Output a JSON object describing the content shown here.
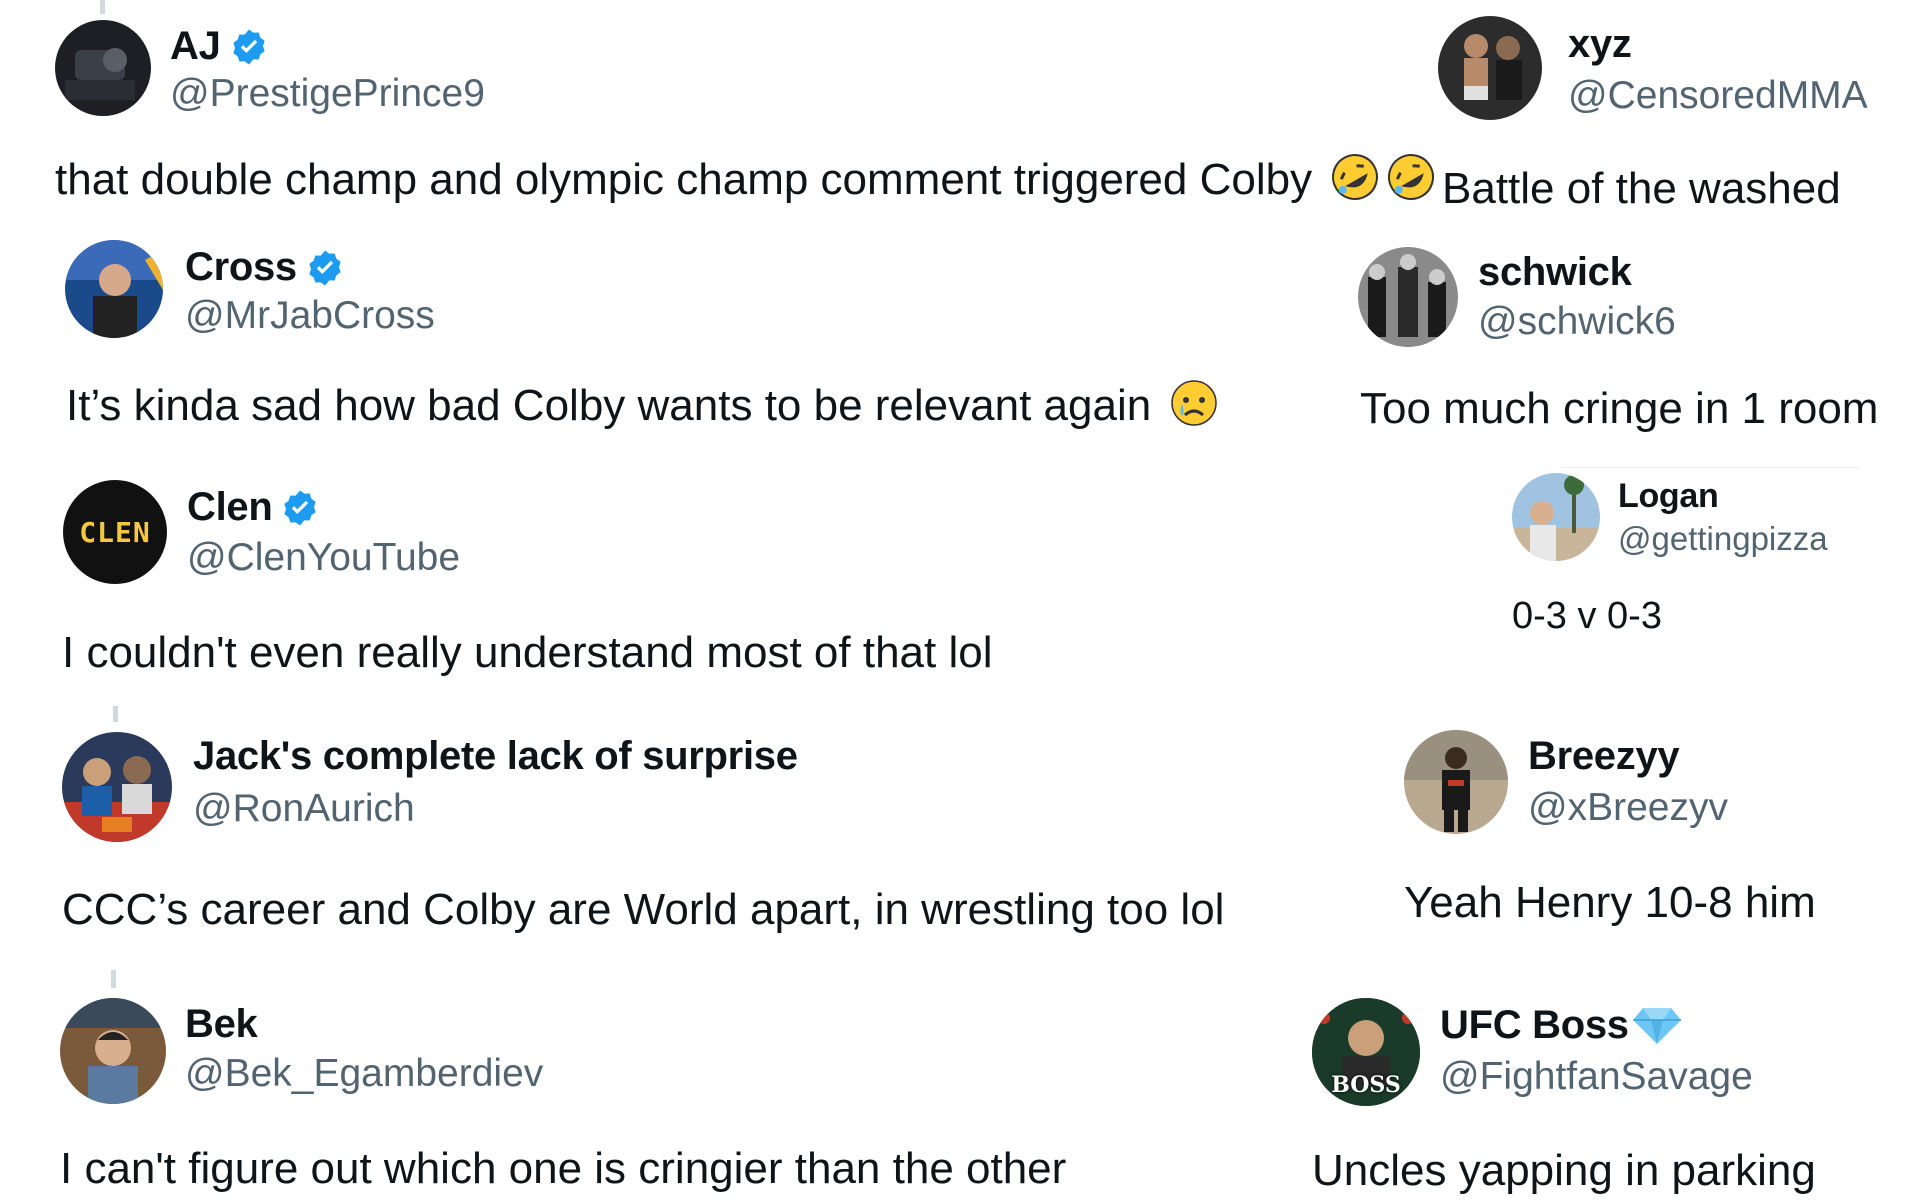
{
  "tweets": [
    {
      "name": "AJ",
      "handle": "@PrestigePrince9",
      "verified": true,
      "text": "that double champ and olympic champ comment triggered Colby",
      "emoji": "rolling-on-floor-laughing x2"
    },
    {
      "name": "xyz",
      "handle": "@CensoredMMA",
      "verified": false,
      "text": "Battle of the washed"
    },
    {
      "name": "Cross",
      "handle": "@MrJabCross",
      "verified": true,
      "text": "It’s kinda sad how bad Colby wants to be relevant again",
      "emoji": "crying-face"
    },
    {
      "name": "schwick",
      "handle": "@schwick6",
      "verified": false,
      "text": "Too much cringe in 1 room"
    },
    {
      "name": "Clen",
      "handle": "@ClenYouTube",
      "verified": true,
      "text": "I couldn't even really understand most of that lol",
      "avatar_text": "CLEN"
    },
    {
      "name": "Logan",
      "handle": "@gettingpizza",
      "verified": false,
      "text": "0-3 v 0-3"
    },
    {
      "name": "Jack's complete lack of surprise",
      "handle": "@RonAurich",
      "verified": false,
      "text": "CCC’s career and Colby are World apart, in wrestling too lol"
    },
    {
      "name": "Breezyy",
      "handle": "@xBreezyv",
      "verified": false,
      "text": "Yeah Henry 10-8 him"
    },
    {
      "name": "Bek",
      "handle": "@Bek_Egamberdiev",
      "verified": false,
      "text": "I can't figure out which one is cringier than the other"
    },
    {
      "name": "UFC Boss",
      "handle": "@FightfanSavage",
      "verified": false,
      "text": "Uncles yapping in parking",
      "name_badge": "gem-stone",
      "avatar_text": "BOSS"
    }
  ],
  "colors": {
    "text": "#0f1419",
    "secondary": "#536471",
    "verified_blue": "#1d9bf0",
    "thread_line": "#cfd9de"
  }
}
